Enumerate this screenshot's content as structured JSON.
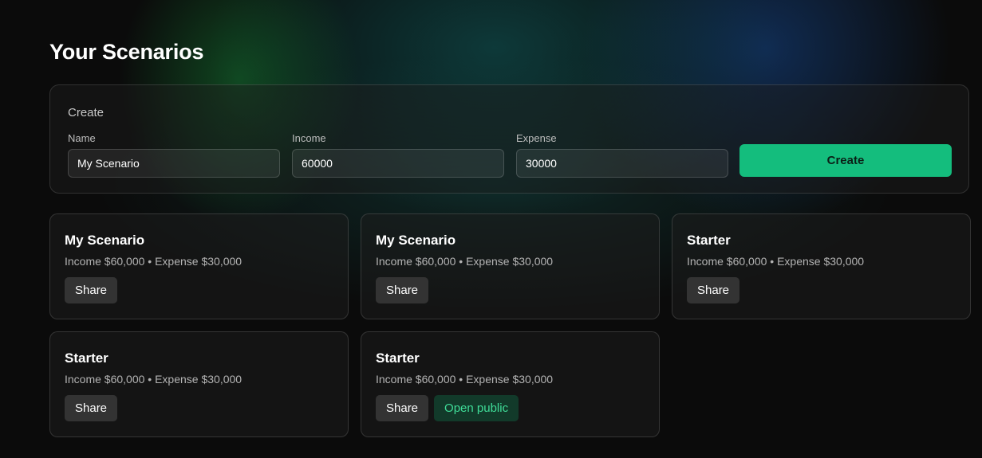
{
  "page": {
    "title": "Your Scenarios"
  },
  "create": {
    "heading": "Create",
    "name_label": "Name",
    "name_value": "My Scenario",
    "income_label": "Income",
    "income_value": "60000",
    "expense_label": "Expense",
    "expense_value": "30000",
    "submit_label": "Create"
  },
  "scenarios": [
    {
      "title": "My Scenario",
      "meta": "Income $60,000 • Expense $30,000",
      "share_label": "Share"
    },
    {
      "title": "My Scenario",
      "meta": "Income $60,000 • Expense $30,000",
      "share_label": "Share"
    },
    {
      "title": "Starter",
      "meta": "Income $60,000 • Expense $30,000",
      "share_label": "Share"
    },
    {
      "title": "Starter",
      "meta": "Income $60,000 • Expense $30,000",
      "share_label": "Share"
    },
    {
      "title": "Starter",
      "meta": "Income $60,000 • Expense $30,000",
      "share_label": "Share",
      "open_public_label": "Open public"
    }
  ],
  "colors": {
    "background": "#0b0b0b",
    "accent": "#14bd7d",
    "open_public_text": "#3fdc98",
    "open_public_bg": "#123a2a"
  }
}
